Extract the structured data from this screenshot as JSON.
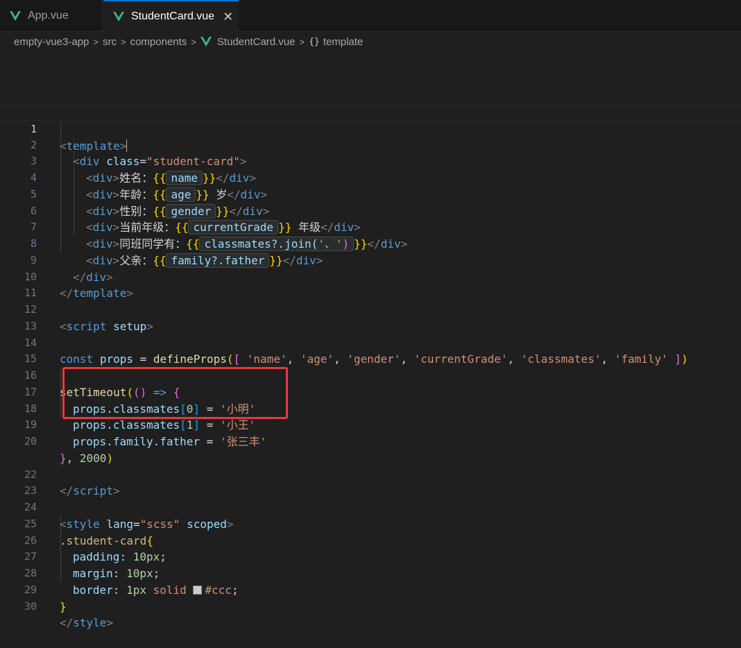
{
  "tabs": [
    {
      "label": "App.vue",
      "active": false
    },
    {
      "label": "StudentCard.vue",
      "active": true,
      "close": "✕"
    }
  ],
  "breadcrumb": {
    "items": [
      "empty-vue3-app",
      "src",
      "components",
      "StudentCard.vue",
      "template"
    ],
    "separator": ">",
    "braces": "{}"
  },
  "line_numbers": [
    "1",
    "2",
    "3",
    "4",
    "5",
    "6",
    "7",
    "8",
    "9",
    "10",
    "11",
    "12",
    "13",
    "14",
    "15",
    "16",
    "17",
    "18",
    "19",
    "20",
    "22",
    "23",
    "24",
    "25",
    "26",
    "27",
    "28",
    "29",
    "30"
  ],
  "code": {
    "l1": [
      "<",
      "template",
      ">"
    ],
    "l2": [
      "<",
      "div",
      " ",
      "class",
      "=",
      "\"student-card\"",
      ">"
    ],
    "l3": [
      "<",
      "div",
      ">",
      "姓名：",
      "{{",
      "name",
      "}}",
      "</",
      "div",
      ">"
    ],
    "l4": [
      "<",
      "div",
      ">",
      "年龄：",
      "{{",
      "age",
      "}}",
      " 岁",
      "</",
      "div",
      ">"
    ],
    "l5": [
      "<",
      "div",
      ">",
      "性别：",
      "{{",
      "gender",
      "}}",
      "</",
      "div",
      ">"
    ],
    "l6": [
      "<",
      "div",
      ">",
      "当前年级：",
      "{{",
      "currentGrade",
      "}}",
      " 年级",
      "</",
      "div",
      ">"
    ],
    "l7": [
      "<",
      "div",
      ">",
      "同班同学有：",
      "{{",
      "classmates?.join(",
      "'、'",
      ")",
      "}}",
      "</",
      "div",
      ">"
    ],
    "l8": [
      "<",
      "div",
      ">",
      "父亲：",
      "{{",
      "family?.father",
      "}}",
      "</",
      "div",
      ">"
    ],
    "l9": [
      "</",
      "div",
      ">"
    ],
    "l10": [
      "</",
      "template",
      ">"
    ],
    "l12": [
      "<",
      "script",
      " ",
      "setup",
      ">"
    ],
    "l14": [
      "const",
      " ",
      "props",
      " = ",
      "defineProps",
      "(",
      "[",
      " ",
      "'name'",
      ", ",
      "'age'",
      ", ",
      "'gender'",
      ", ",
      "'currentGrade'",
      ", ",
      "'classmates'",
      ", ",
      "'family'",
      " ",
      "]",
      ")"
    ],
    "l16": [
      "setTimeout",
      "(",
      "()",
      " => ",
      "{"
    ],
    "l17": [
      "props",
      ".",
      "classmates",
      "[",
      "0",
      "]",
      " = ",
      "'小明'"
    ],
    "l18": [
      "props",
      ".",
      "classmates",
      "[",
      "1",
      "]",
      " = ",
      "'小王'"
    ],
    "l19": [
      "props",
      ".",
      "family",
      ".",
      "father",
      " = ",
      "'张三丰'"
    ],
    "l20": [
      "}",
      ", ",
      "2000",
      ")"
    ],
    "l22": [
      "</",
      "script",
      ">"
    ],
    "l24": [
      "<",
      "style",
      " ",
      "lang",
      "=",
      "\"scss\"",
      " ",
      "scoped",
      ">"
    ],
    "l25": [
      ".student-card",
      "{"
    ],
    "l26": [
      "padding",
      ": ",
      "10px",
      ";"
    ],
    "l27": [
      "margin",
      ": ",
      "10px",
      ";"
    ],
    "l28": [
      "border",
      ": ",
      "1px",
      " solid ",
      "#ccc",
      ";"
    ],
    "l29": [
      "}"
    ],
    "l30": [
      "</",
      "style",
      ">"
    ]
  },
  "colors": {
    "highlight_border": "#e8383f",
    "active_tab_accent": "#0078d4",
    "vue_logo": "#41b883"
  },
  "icons": [
    "vue-logo-icon",
    "close-icon",
    "chevron-right-icon",
    "braces-icon"
  ]
}
